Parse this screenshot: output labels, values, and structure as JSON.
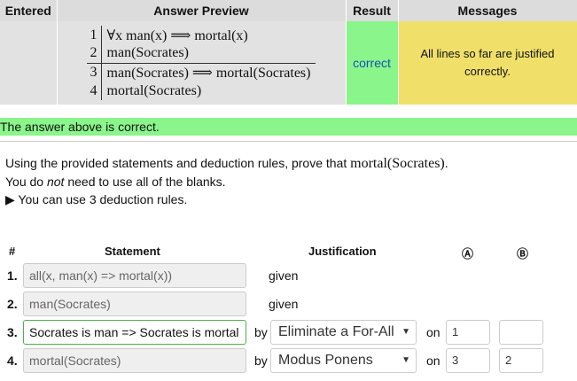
{
  "results_table": {
    "headers": {
      "entered": "Entered",
      "preview": "Answer Preview",
      "result": "Result",
      "messages": "Messages"
    },
    "preview_lines": [
      {
        "num": "1",
        "text": "∀x man(x)  ⟹  mortal(x)"
      },
      {
        "num": "2",
        "text": "man(Socrates)"
      },
      {
        "num": "3",
        "text": "man(Socrates)  ⟹  mortal(Socrates)"
      },
      {
        "num": "4",
        "text": "mortal(Socrates)"
      }
    ],
    "result": "correct",
    "message": "All lines so far are justified correctly."
  },
  "banner": "The answer above is correct.",
  "intro": {
    "line1_prefix": "Using the provided statements and deduction rules, prove that ",
    "line1_math": "mortal(Socrates)",
    "line1_suffix": ".",
    "line2_a": "You do ",
    "line2_em": "not",
    "line2_b": " need to use all of the blanks.",
    "line3": "▶ You can use 3 deduction rules."
  },
  "proof_table": {
    "headers": {
      "num": "#",
      "statement": "Statement",
      "justification": "Justification",
      "ref_a": "Ⓐ",
      "ref_b": "Ⓑ"
    },
    "rows": [
      {
        "num": "1.",
        "statement": "all(x, man(x) => mortal(x))",
        "justification": "given"
      },
      {
        "num": "2.",
        "statement": "man(Socrates)",
        "justification": "given"
      },
      {
        "num": "3.",
        "statement": "Socrates is man => Socrates is mortal",
        "by": "by",
        "rule": "Eliminate a For-All",
        "on": "on",
        "ref_a": "1",
        "ref_b": ""
      },
      {
        "num": "4.",
        "statement": "mortal(Socrates)",
        "by": "by",
        "rule": "Modus Ponens",
        "on": "on",
        "ref_a": "3",
        "ref_b": "2"
      }
    ]
  }
}
